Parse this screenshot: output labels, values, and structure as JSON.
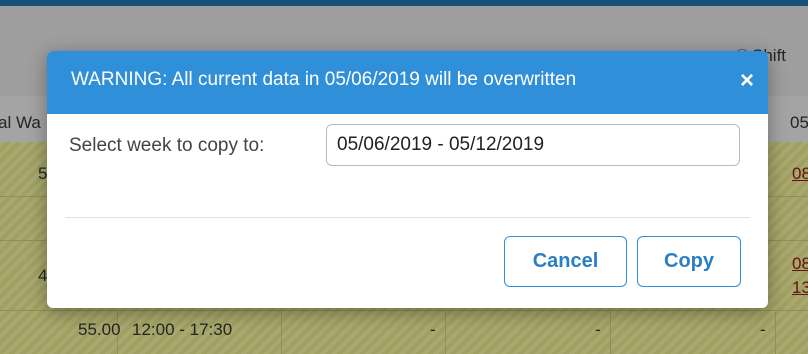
{
  "background": {
    "shift_label": "Shift",
    "col_header_left": "al Wa",
    "col_header_right": "05",
    "rows": [
      {
        "left": "5",
        "right": "08"
      },
      {
        "left": "4",
        "right": "08"
      },
      {
        "hours": "55.00",
        "time": "12:00 - 17:30",
        "c3": "-",
        "c4": "-",
        "c5": "-"
      }
    ],
    "row2_right_line2": "13"
  },
  "modal": {
    "title": "WARNING: All current data in 05/06/2019 will be overwritten",
    "close_glyph": "×",
    "field_label": "Select week to copy to:",
    "week_value": "05/06/2019 - 05/12/2019",
    "cancel_label": "Cancel",
    "copy_label": "Copy"
  },
  "colors": {
    "header_blue": "#2f8fd8",
    "button_text_blue": "#2a7fc4",
    "row_highlight": "#e9e99a"
  }
}
